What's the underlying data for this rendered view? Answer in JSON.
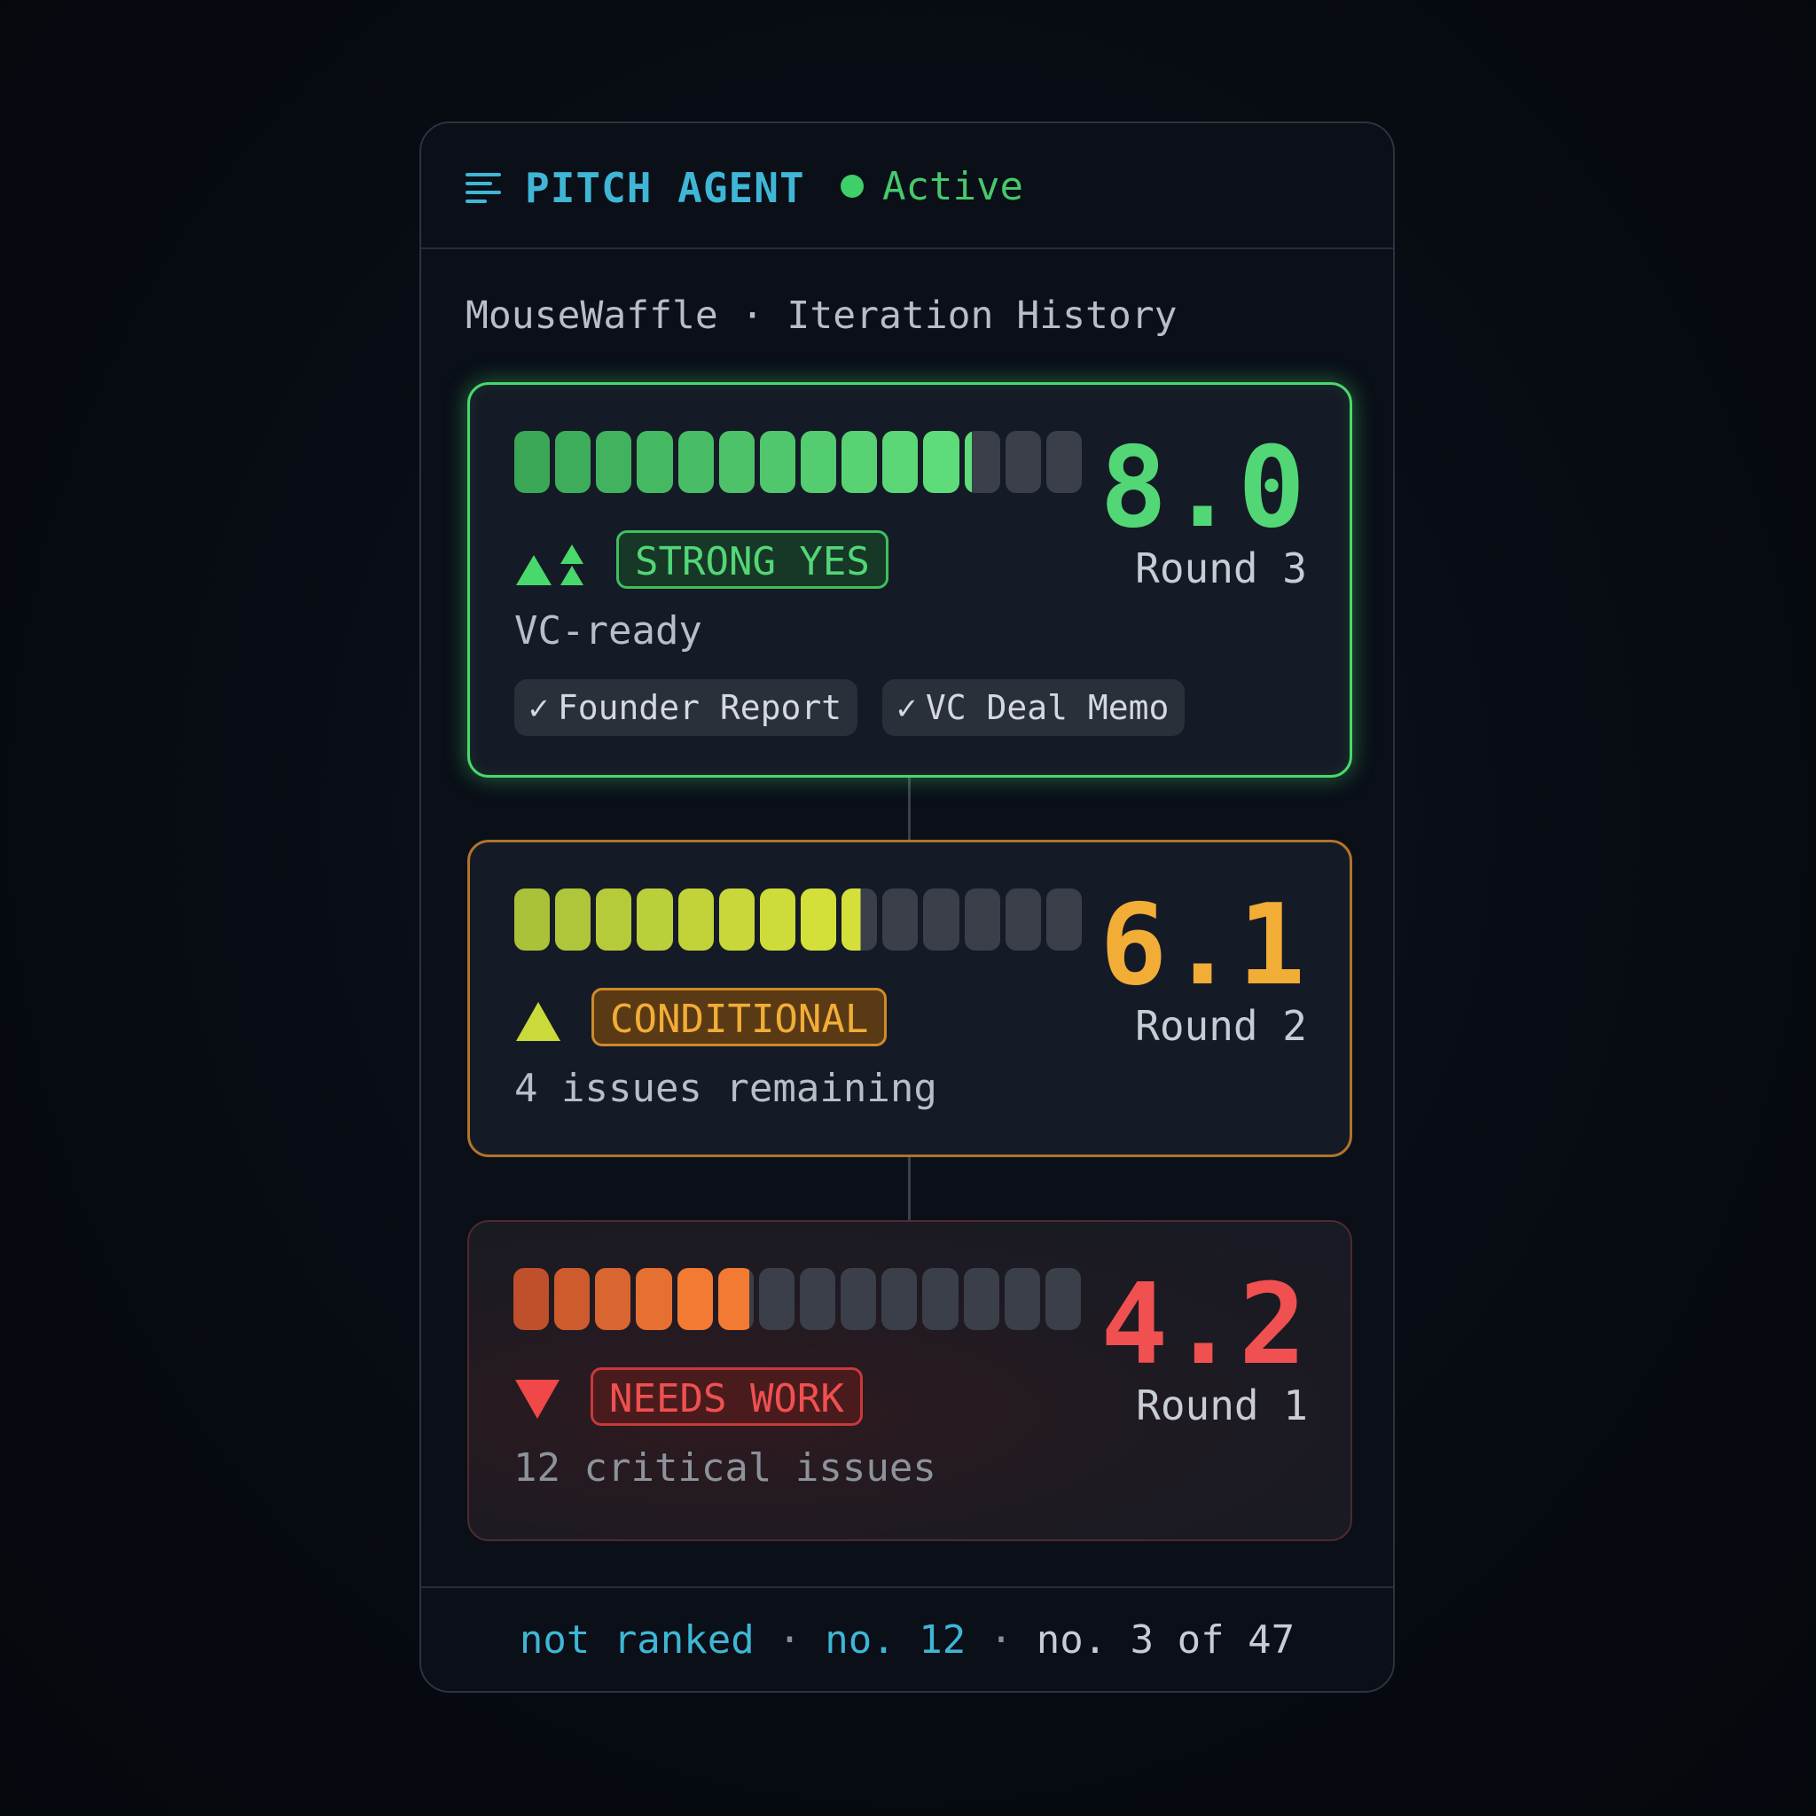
{
  "header": {
    "title": "PITCH AGENT",
    "status": "Active",
    "icon": "menu-lines-icon"
  },
  "subtitle": "MouseWaffle · Iteration History",
  "rounds": [
    {
      "score": "8.0",
      "round": "Round 3",
      "verdict": "STRONG YES",
      "note": "VC-ready",
      "progress": 0.8,
      "color": "#52d676",
      "trend_icon": "double-up-arrow-icon",
      "chips": [
        "Founder Report",
        "VC Deal Memo"
      ],
      "chip_icon": "check-icon"
    },
    {
      "score": "6.1",
      "round": "Round 2",
      "verdict": "CONDITIONAL",
      "note": "4 issues remaining",
      "progress": 0.61,
      "color": "#f2ad37",
      "trend_icon": "up-arrow-icon"
    },
    {
      "score": "4.2",
      "round": "Round 1",
      "verdict": "NEEDS WORK",
      "note": "12 critical issues",
      "progress": 0.42,
      "color": "#f05050",
      "trend_icon": "down-arrow-icon"
    }
  ],
  "footer": {
    "part1": "not ranked",
    "part2": "no. 12",
    "part3": "no. 3 of 47",
    "separator": "·"
  }
}
